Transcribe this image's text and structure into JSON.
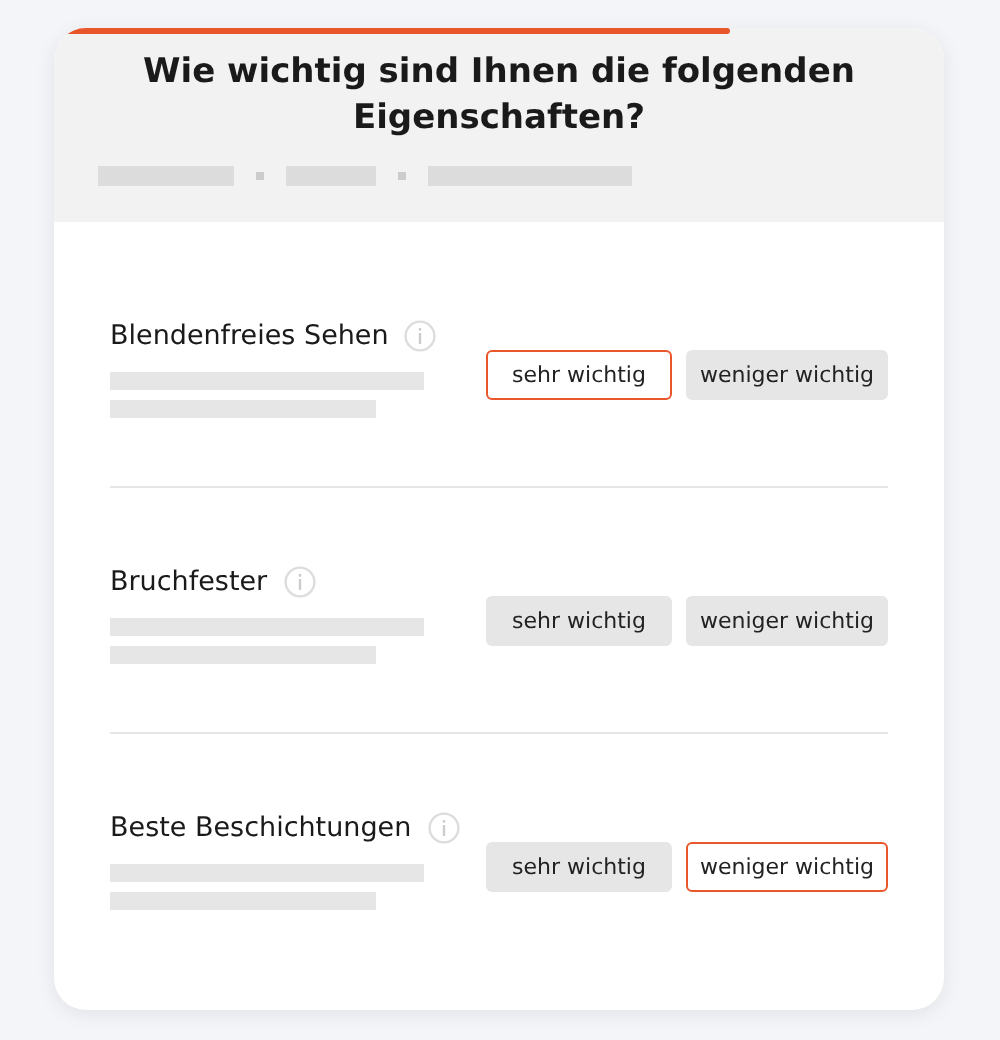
{
  "progress": {
    "level": 0.76
  },
  "title": "Wie wichtig sind Ihnen die folgenden Eigenschaften?",
  "items": [
    {
      "label": "Blendenfreies Sehen",
      "options": [
        {
          "label": "sehr wichtig",
          "selected": true
        },
        {
          "label": "weniger wichtig",
          "selected": false
        }
      ]
    },
    {
      "label": "Bruchfester",
      "options": [
        {
          "label": "sehr wichtig",
          "selected": false
        },
        {
          "label": "weniger wichtig",
          "selected": false
        }
      ]
    },
    {
      "label": "Beste Beschichtungen",
      "options": [
        {
          "label": "sehr wichtig",
          "selected": false
        },
        {
          "label": "weniger wichtig",
          "selected": true
        }
      ]
    }
  ]
}
